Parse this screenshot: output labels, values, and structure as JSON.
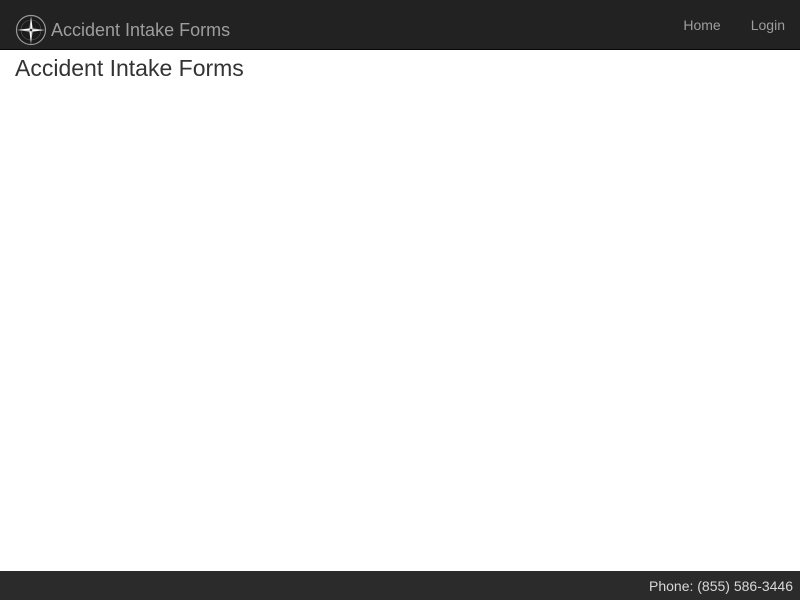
{
  "navbar": {
    "brand": {
      "icon": "compass-rose-icon",
      "label": "Accident Intake Forms"
    },
    "links": [
      {
        "label": "Home"
      },
      {
        "label": "Login"
      }
    ]
  },
  "main": {
    "title": "Accident Intake Forms"
  },
  "footer": {
    "phone": "Phone: (855) 586-3446"
  },
  "colors": {
    "navbar_bg": "#222222",
    "nav_text": "#9d9d9d",
    "footer_bg": "#2b2b2c",
    "footer_text": "#d8d8d8",
    "title_text": "#333333"
  }
}
